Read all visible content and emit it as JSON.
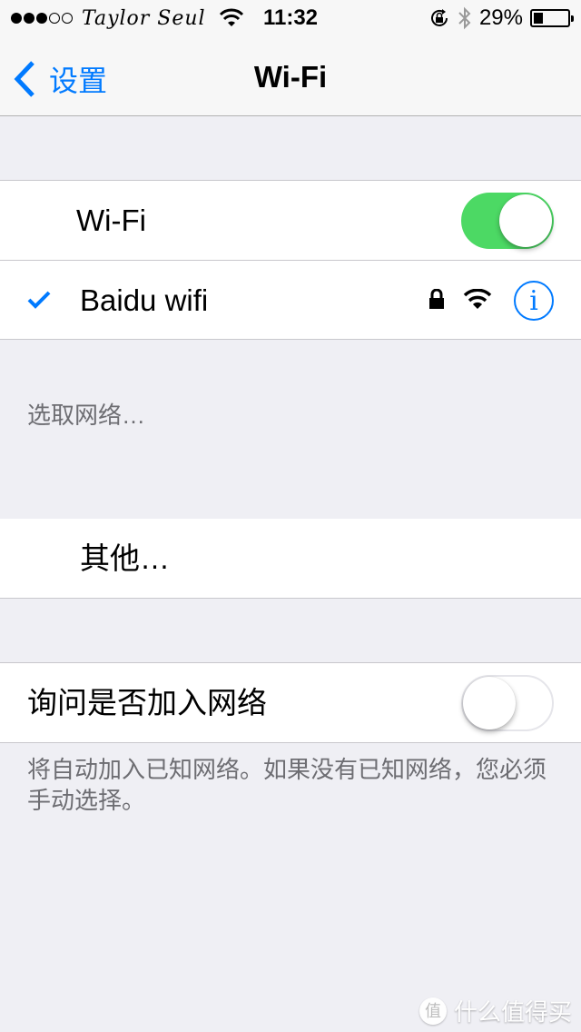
{
  "status_bar": {
    "signal_bars_filled": 3,
    "signal_bars_total": 5,
    "carrier": "Taylor Seul",
    "time": "11:32",
    "battery_percent_label": "29%",
    "battery_level": 0.29,
    "icons": [
      "wifi-icon",
      "rotation-lock-icon",
      "bluetooth-icon",
      "battery-icon"
    ]
  },
  "nav": {
    "back_label": "设置",
    "title": "Wi-Fi"
  },
  "wifi_group": {
    "wifi_label": "Wi-Fi",
    "wifi_enabled": true,
    "connected_network": {
      "name": "Baidu wifi",
      "selected": true,
      "secured": true,
      "info_glyph": "i"
    }
  },
  "choose_network": {
    "header": "选取网络…",
    "other_label": "其他…"
  },
  "ask_join": {
    "label": "询问是否加入网络",
    "enabled": false,
    "footer": "将自动加入已知网络。如果没有已知网络，您必须手动选择。"
  },
  "watermark": {
    "badge": "值",
    "text": "什么值得买"
  },
  "colors": {
    "accent": "#007aff",
    "toggle_on": "#4cd964",
    "background": "#efeff4",
    "secondary_text": "#6d6d72"
  }
}
